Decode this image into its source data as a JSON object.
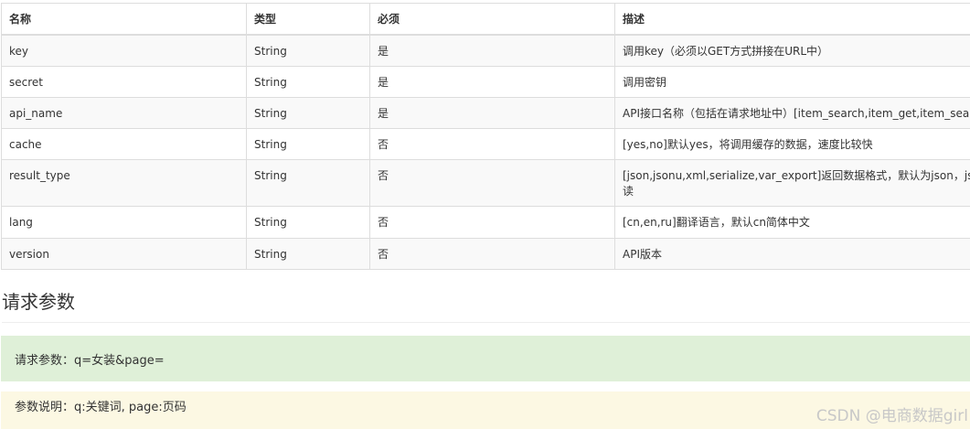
{
  "table": {
    "headers": [
      "名称",
      "类型",
      "必须",
      "描述"
    ],
    "rows": [
      {
        "name": "key",
        "type": "String",
        "required": "是",
        "desc": "调用key（必须以GET方式拼接在URL中）"
      },
      {
        "name": "secret",
        "type": "String",
        "required": "是",
        "desc": "调用密钥"
      },
      {
        "name": "api_name",
        "type": "String",
        "required": "是",
        "desc": "API接口名称（包括在请求地址中）[item_search,item_get,item_search_"
      },
      {
        "name": "cache",
        "type": "String",
        "required": "否",
        "desc": "[yes,no]默认yes，将调用缓存的数据，速度比较快"
      },
      {
        "name": "result_type",
        "type": "String",
        "required": "否",
        "desc": "[json,jsonu,xml,serialize,var_export]返回数据格式，默认为json，jsonu输",
        "desc2": "读"
      },
      {
        "name": "lang",
        "type": "String",
        "required": "否",
        "desc": "[cn,en,ru]翻译语言，默认cn简体中文"
      },
      {
        "name": "version",
        "type": "String",
        "required": "否",
        "desc": "API版本"
      }
    ]
  },
  "section": {
    "title": "请求参数"
  },
  "request_params": {
    "text": "请求参数：q=女装&page="
  },
  "params_desc": {
    "text": "参数说明：q:关键词, page:页码"
  },
  "watermark": "CSDN @电商数据girl"
}
